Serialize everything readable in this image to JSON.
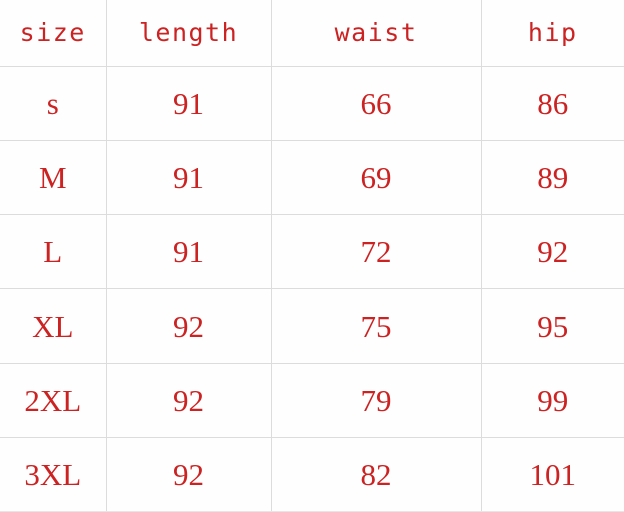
{
  "table": {
    "columns": [
      {
        "key": "size",
        "label": "size"
      },
      {
        "key": "length",
        "label": "length"
      },
      {
        "key": "waist",
        "label": "waist"
      },
      {
        "key": "hip",
        "label": "hip"
      }
    ],
    "rows": [
      {
        "size": "s",
        "length": "91",
        "waist": "66",
        "hip": "86"
      },
      {
        "size": "M",
        "length": "91",
        "waist": "69",
        "hip": "89"
      },
      {
        "size": "L",
        "length": "91",
        "waist": "72",
        "hip": "92"
      },
      {
        "size": "XL",
        "length": "92",
        "waist": "75",
        "hip": "95"
      },
      {
        "size": "2XL",
        "length": "92",
        "waist": "79",
        "hip": "99"
      },
      {
        "size": "3XL",
        "length": "92",
        "waist": "82",
        "hip": "101"
      }
    ],
    "colors": {
      "text": "#cc2222",
      "gridline": "#dcdcdc",
      "background": "#fefefe"
    }
  }
}
